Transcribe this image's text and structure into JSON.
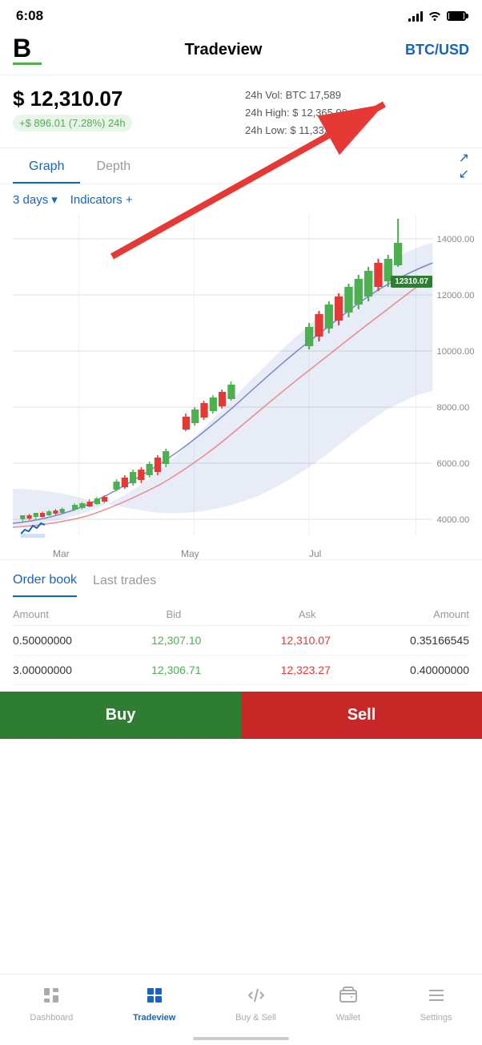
{
  "statusBar": {
    "time": "6:08",
    "location": "↗"
  },
  "header": {
    "logoText": "B",
    "title": "Tradeview",
    "pair": "BTC/USD"
  },
  "price": {
    "main": "$ 12,310.07",
    "change": "+$ 896.01 (7.28%) 24h",
    "vol": "24h Vol: BTC 17,589",
    "high": "24h High: $ 12,365.98",
    "low": "24h Low: $ 11,332.19"
  },
  "tabs": {
    "graph": "Graph",
    "depth": "Depth"
  },
  "chartControls": {
    "period": "3 days",
    "indicators": "Indicators +"
  },
  "chartPriceLabel": "12310.07",
  "yAxis": {
    "labels": [
      "14000.00",
      "12000.00",
      "10000.00",
      "8000.00",
      "6000.00",
      "4000.00"
    ]
  },
  "xAxis": {
    "labels": [
      "Mar",
      "May",
      "Jul"
    ]
  },
  "orderBook": {
    "tab1": "Order book",
    "tab2": "Last trades",
    "headers": {
      "amount": "Amount",
      "bid": "Bid",
      "ask": "Ask",
      "amount2": "Amount"
    },
    "rows": [
      {
        "amount": "0.50000000",
        "bid": "12,307.10",
        "ask": "12,310.07",
        "amount2": "0.35166545"
      },
      {
        "amount": "3.00000000",
        "bid": "12,306.71",
        "ask": "12,323.27",
        "amount2": "0.40000000"
      }
    ]
  },
  "buttons": {
    "buy": "Buy",
    "sell": "Sell"
  },
  "bottomNav": {
    "items": [
      {
        "id": "dashboard",
        "label": "Dashboard",
        "icon": "dashboard"
      },
      {
        "id": "tradeview",
        "label": "Tradeview",
        "icon": "tradeview",
        "active": true
      },
      {
        "id": "buysell",
        "label": "Buy & Sell",
        "icon": "buysell"
      },
      {
        "id": "wallet",
        "label": "Wallet",
        "icon": "wallet"
      },
      {
        "id": "settings",
        "label": "Settings",
        "icon": "settings"
      }
    ]
  }
}
